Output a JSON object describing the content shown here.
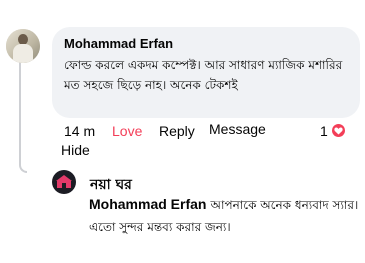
{
  "comment": {
    "author": "Mohammad Erfan",
    "text": "ফোল্ড করলে একদম কম্পেক্ট। আর সাধারণ ম্যাজিক মশারির মত সহজে ছিড়ে নাহ। অনেক টেকশই",
    "time": "14 m",
    "love_label": "Love",
    "reply_label": "Reply",
    "message_label": "Message",
    "hide_label": "Hide",
    "reaction_count": "1",
    "reaction_icon": "heart-icon",
    "reaction_color": "#f33e58"
  },
  "reply": {
    "page_name": "নয়া ঘর",
    "mention": "Mohammad Erfan",
    "text": "আপনাকে অনেক ধন্যবাদ স্যার। এতো সুন্দর মন্তব্য করার জন্য।"
  }
}
